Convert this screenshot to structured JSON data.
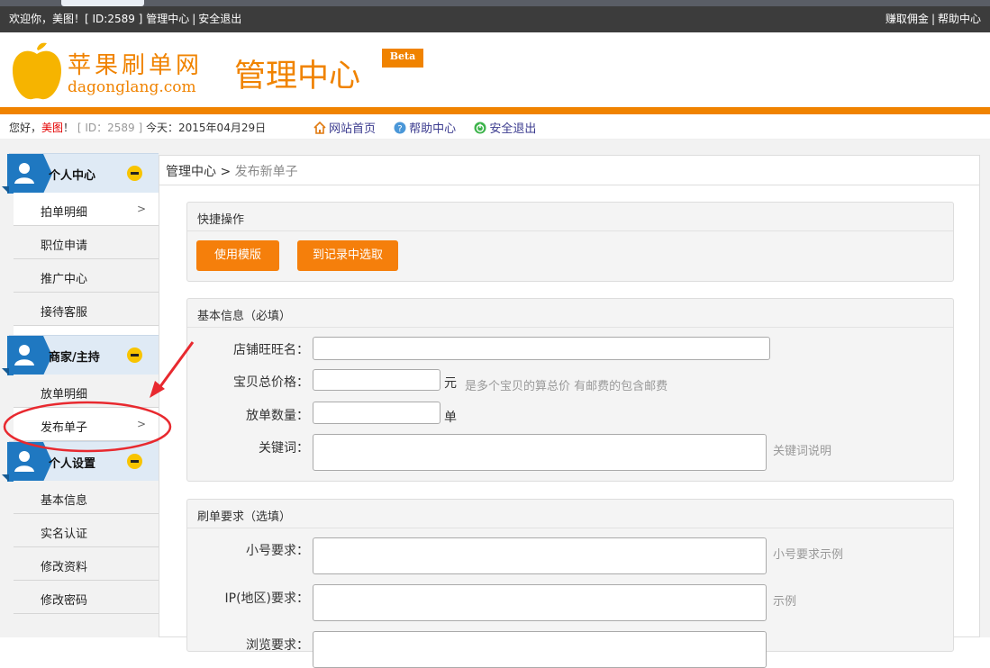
{
  "topbar": {
    "welcome": "欢迎你，美图！[ ID:2589 ]",
    "admin": "管理中心",
    "logout": "安全退出",
    "earn": "赚取佣金",
    "help": "帮助中心"
  },
  "header": {
    "logo_cn": "苹果刷单网",
    "logo_en": "dagonglang.com",
    "title": "管理中心",
    "beta": "Beta"
  },
  "infobar": {
    "greeting_prefix": "您好，",
    "username": "美图",
    "greeting_bang": "！",
    "id_text": "[ ID：2589 ]",
    "today_label": "今天：2015年04月29日",
    "home": "网站首页",
    "help": "帮助中心",
    "logout": "安全退出"
  },
  "sidebar": {
    "sections": [
      {
        "title": "个人中心",
        "items": [
          {
            "label": "拍单明细",
            "chevron": ">"
          },
          {
            "label": "职位申请"
          },
          {
            "label": "推广中心"
          },
          {
            "label": "接待客服"
          }
        ]
      },
      {
        "title": "商家/主持",
        "items": [
          {
            "label": "放单明细"
          },
          {
            "label": "发布单子",
            "chevron": ">"
          }
        ]
      },
      {
        "title": "个人设置",
        "items": [
          {
            "label": "基本信息"
          },
          {
            "label": "实名认证"
          },
          {
            "label": "修改资料"
          },
          {
            "label": "修改密码"
          }
        ]
      }
    ]
  },
  "breadcrumb": {
    "root": "管理中心",
    "sep": " > ",
    "current": "发布新单子"
  },
  "quick": {
    "title": "快捷操作",
    "btn_template": "使用模版",
    "btn_record": "到记录中选取"
  },
  "basic": {
    "title": "基本信息（必填）",
    "shop_label": "店铺旺旺名：",
    "price_label": "宝贝总价格：",
    "price_unit": "元",
    "price_hint": "是多个宝贝的算总价 有邮费的包含邮费",
    "qty_label": "放单数量：",
    "qty_unit": "单",
    "kw_label": "关键词：",
    "kw_hint": "关键词说明"
  },
  "extra": {
    "title": "刷单要求（选填）",
    "acct_label": "小号要求：",
    "acct_hint": "小号要求示例",
    "ip_label": "IP(地区)要求：",
    "ip_hint": "示例",
    "next_label": "浏览要求："
  },
  "colors": {
    "brand_orange": "#f08300",
    "button_orange": "#f57f0b",
    "sidebar_blue": "#1f78c1",
    "annotation_red": "#e8292f"
  }
}
